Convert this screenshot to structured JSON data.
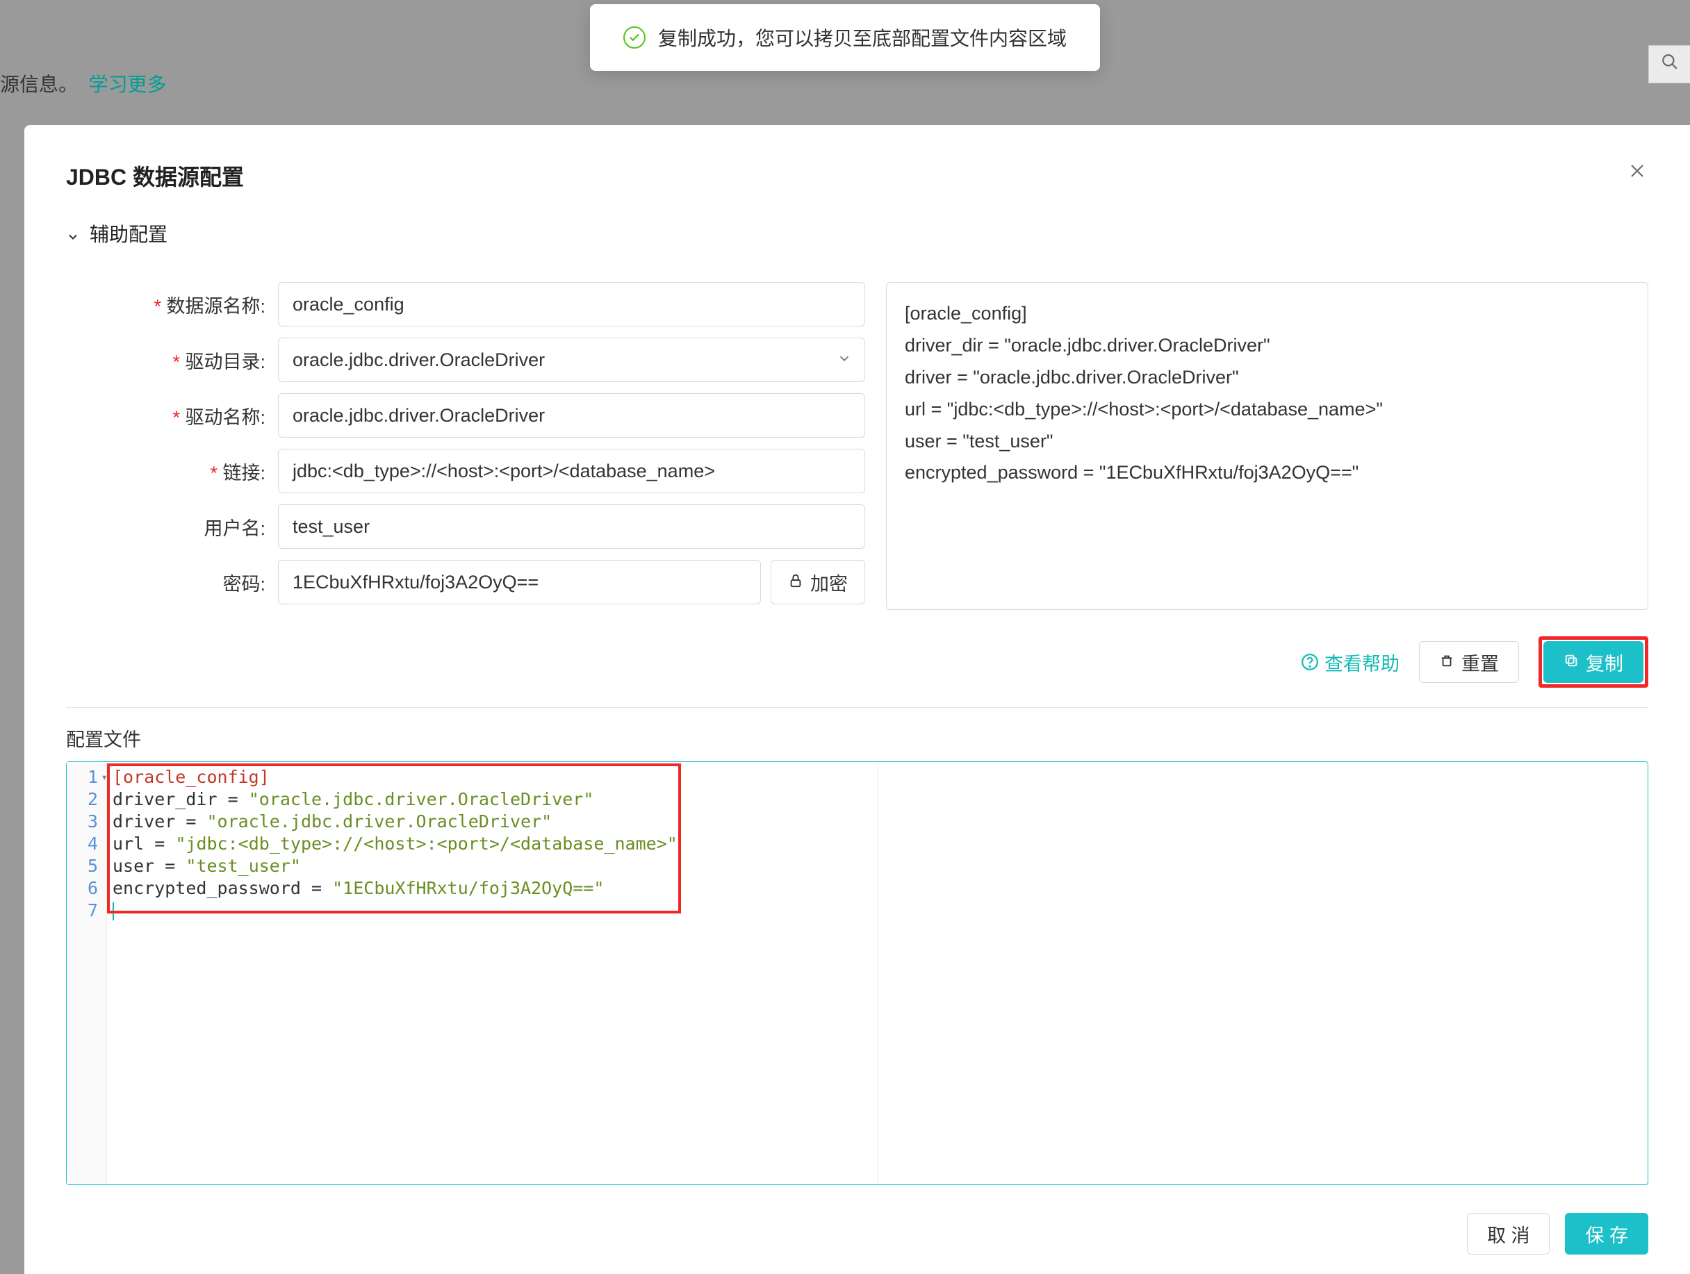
{
  "background": {
    "info_text": "源信息。",
    "learn_more": "学习更多"
  },
  "toast": {
    "message": "复制成功，您可以拷贝至底部配置文件内容区域"
  },
  "modal": {
    "title": "JDBC 数据源配置",
    "section_title": "辅助配置",
    "config_file_label": "配置文件"
  },
  "form": {
    "labels": {
      "name": "数据源名称:",
      "driver_dir": "驱动目录:",
      "driver_name": "驱动名称:",
      "url": "链接:",
      "username": "用户名:",
      "password": "密码:"
    },
    "values": {
      "name": "oracle_config",
      "driver_dir": "oracle.jdbc.driver.OracleDriver",
      "driver_name": "oracle.jdbc.driver.OracleDriver",
      "url": "jdbc:<db_type>://<host>:<port>/<database_name>",
      "username": "test_user",
      "password": "1ECbuXfHRxtu/foj3A2OyQ=="
    },
    "encrypt_button": "加密"
  },
  "preview": {
    "text": "[oracle_config]\ndriver_dir = \"oracle.jdbc.driver.OracleDriver\"\ndriver = \"oracle.jdbc.driver.OracleDriver\"\nurl = \"jdbc:<db_type>://<host>:<port>/<database_name>\"\nuser = \"test_user\"\nencrypted_password = \"1ECbuXfHRxtu/foj3A2OyQ==\""
  },
  "actions": {
    "help": "查看帮助",
    "reset": "重置",
    "copy": "复制",
    "cancel": "取 消",
    "save": "保 存"
  },
  "code": {
    "lines": [
      {
        "n": "1",
        "segs": [
          {
            "t": "[oracle_config]",
            "c": "h"
          }
        ]
      },
      {
        "n": "2",
        "segs": [
          {
            "t": "driver_dir ",
            "c": "o"
          },
          {
            "t": "=",
            "c": "o"
          },
          {
            "t": " ",
            "c": "o"
          },
          {
            "t": "\"oracle.jdbc.driver.OracleDriver\"",
            "c": "s"
          }
        ]
      },
      {
        "n": "3",
        "segs": [
          {
            "t": "driver ",
            "c": "o"
          },
          {
            "t": "=",
            "c": "o"
          },
          {
            "t": " ",
            "c": "o"
          },
          {
            "t": "\"oracle.jdbc.driver.OracleDriver\"",
            "c": "s"
          }
        ]
      },
      {
        "n": "4",
        "segs": [
          {
            "t": "url ",
            "c": "o"
          },
          {
            "t": "=",
            "c": "o"
          },
          {
            "t": " ",
            "c": "o"
          },
          {
            "t": "\"jdbc:<db_type>://<host>:<port>/<database_name>\"",
            "c": "s"
          }
        ]
      },
      {
        "n": "5",
        "segs": [
          {
            "t": "user ",
            "c": "o"
          },
          {
            "t": "=",
            "c": "o"
          },
          {
            "t": " ",
            "c": "o"
          },
          {
            "t": "\"test_user\"",
            "c": "s"
          }
        ]
      },
      {
        "n": "6",
        "segs": [
          {
            "t": "encrypted_password ",
            "c": "o"
          },
          {
            "t": "=",
            "c": "o"
          },
          {
            "t": " ",
            "c": "o"
          },
          {
            "t": "\"1ECbuXfHRxtu/foj3A2OyQ==\"",
            "c": "s"
          }
        ]
      },
      {
        "n": "7",
        "segs": []
      }
    ]
  }
}
